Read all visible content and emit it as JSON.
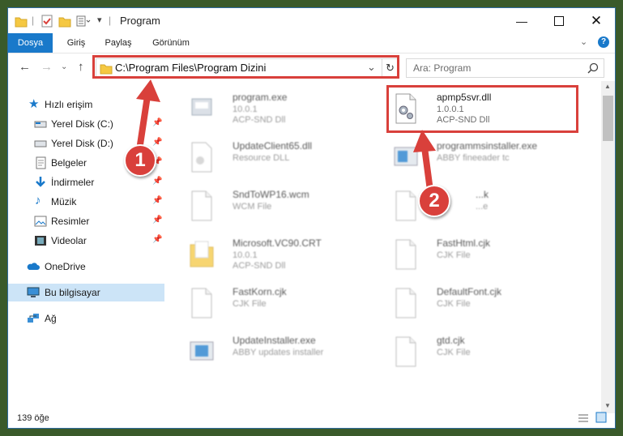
{
  "window": {
    "title": "Program",
    "accent": "#1979ca",
    "annotation_color": "#d9403b"
  },
  "ribbon": {
    "tabs": [
      "Dosya",
      "Giriş",
      "Paylaş",
      "Görünüm"
    ]
  },
  "address": {
    "path": "C:\\Program Files\\Program Dizini"
  },
  "search": {
    "placeholder": "Ara: Program"
  },
  "nav": {
    "quick_access": "Hızlı erişim",
    "items": [
      {
        "label": "Yerel Disk (C:)",
        "icon": "drive-icon",
        "pinned": true
      },
      {
        "label": "Yerel Disk (D:)",
        "icon": "drive-icon",
        "pinned": true
      },
      {
        "label": "Belgeler",
        "icon": "documents-icon",
        "pinned": true
      },
      {
        "label": "İndirmeler",
        "icon": "download-icon",
        "pinned": true
      },
      {
        "label": "Müzik",
        "icon": "music-icon",
        "pinned": true
      },
      {
        "label": "Resimler",
        "icon": "pictures-icon",
        "pinned": true
      },
      {
        "label": "Videolar",
        "icon": "videos-icon",
        "pinned": true
      }
    ],
    "onedrive": "OneDrive",
    "this_pc": "Bu bilgisayar",
    "network": "Ağ"
  },
  "files": [
    {
      "name": "program.exe",
      "line1": "10.0.1",
      "line2": "ACP-SND Dll",
      "icon": "exe-icon"
    },
    {
      "name": "apmp5svr.dll",
      "line1": "1.0.0.1",
      "line2": "ACP-SND Dll",
      "icon": "dll-gear-icon",
      "highlighted": true
    },
    {
      "name": "UpdateClient65.dll",
      "line1": "Resource DLL",
      "line2": "",
      "icon": "dll-icon"
    },
    {
      "name": "programmsinstaller.exe",
      "line1": "ABBY fineeader tc",
      "line2": "",
      "icon": "exe-blue-icon"
    },
    {
      "name": "SndToWP16.wcm",
      "line1": "WCM File",
      "line2": "",
      "icon": "file-icon"
    },
    {
      "name": "...k",
      "line1": "...e",
      "line2": "",
      "icon": "file-icon"
    },
    {
      "name": "Microsoft.VC90.CRT",
      "line1": "10.0.1",
      "line2": "ACP-SND Dll",
      "icon": "folder-icon"
    },
    {
      "name": "FastHtml.cjk",
      "line1": "CJK File",
      "line2": "",
      "icon": "file-icon"
    },
    {
      "name": "FastKorn.cjk",
      "line1": "CJK File",
      "line2": "",
      "icon": "file-icon"
    },
    {
      "name": "DefaultFont.cjk",
      "line1": "CJK File",
      "line2": "",
      "icon": "file-icon"
    },
    {
      "name": "UpdateInstaller.exe",
      "line1": "ABBY updates installer",
      "line2": "",
      "icon": "exe-blue-icon"
    },
    {
      "name": "gtd.cjk",
      "line1": "CJK File",
      "line2": "",
      "icon": "file-icon"
    }
  ],
  "status": {
    "count": "139 öğe"
  },
  "annotations": {
    "badge1": "1",
    "badge2": "2"
  }
}
